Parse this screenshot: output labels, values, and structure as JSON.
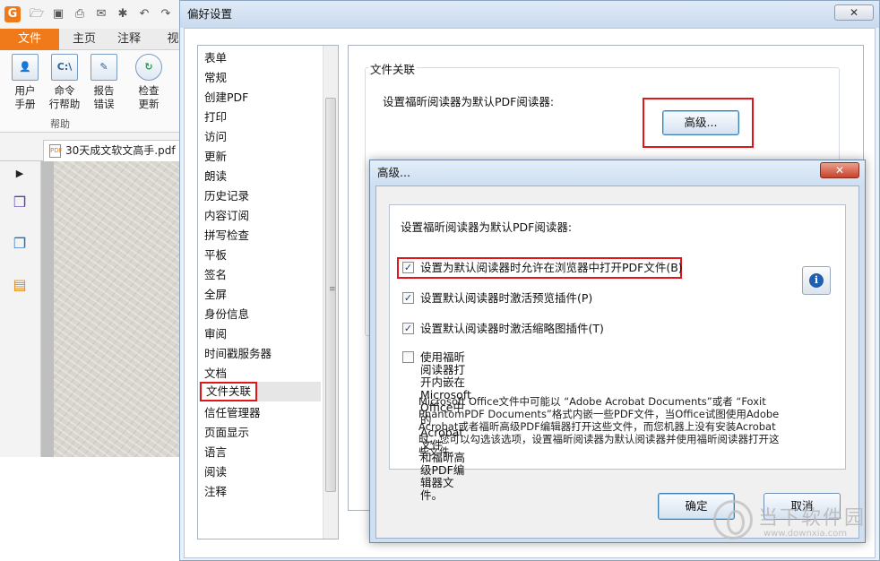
{
  "app": {
    "quick_access_icons": [
      "open-icon",
      "save-icon",
      "print-icon",
      "email-icon",
      "new-icon",
      "undo-icon",
      "redo-icon"
    ],
    "ribbon_tabs": [
      "文件",
      "主页",
      "注释",
      "视"
    ],
    "ribbon_buttons": [
      {
        "label": "用户\n手册",
        "icon": "user-manual-icon"
      },
      {
        "label": "命令\n行帮助",
        "icon": "command-line-icon",
        "icon_text": "C:\\"
      },
      {
        "label": "报告\n错误",
        "icon": "report-error-icon"
      },
      {
        "label": "检查\n更新",
        "icon": "check-update-icon"
      }
    ],
    "ribbon_group_label": "帮助",
    "document_tab": "30天成文软文高手.pdf",
    "colors": {
      "accent": "#f07a1a"
    }
  },
  "preferences": {
    "title": "偏好设置",
    "categories": [
      "表单",
      "常规",
      "创建PDF",
      "打印",
      "访问",
      "更新",
      "朗读",
      "历史记录",
      "内容订阅",
      "拼写检查",
      "平板",
      "签名",
      "全屏",
      "身份信息",
      "审阅",
      "时间戳服务器",
      "文档",
      "文件关联",
      "信任管理器",
      "页面显示",
      "语言",
      "阅读",
      "注释"
    ],
    "selected_category": "文件关联",
    "file_association": {
      "group_title": "文件关联",
      "default_reader_label": "设置福昕阅读器为默认PDF阅读器:",
      "advanced_button": "高级..."
    }
  },
  "advanced_dialog": {
    "title": "高级...",
    "heading": "设置福昕阅读器为默认PDF阅读器:",
    "options": [
      {
        "label": "设置为默认阅读器时允许在浏览器中打开PDF文件(B)",
        "checked": true
      },
      {
        "label": "设置默认阅读器时激活预览插件(P)",
        "checked": true
      },
      {
        "label": "设置默认阅读器时激活缩略图插件(T)",
        "checked": true
      },
      {
        "label": "使用福昕阅读器打开内嵌在Microsoft Office中的Acrobat文件\n和福昕高级PDF编辑器文件。",
        "checked": false
      }
    ],
    "description": "Microsoft Office文件中可能以 “Adobe Acrobat Documents”或者 “Foxit\nPhantomPDF Documents”格式内嵌一些PDF文件，当Office试图使用Adobe\nAcrobat或者福昕高级PDF编辑器打开这些文件，而您机器上没有安装Acrobat\n时，您可以勾选该选项，设置福昕阅读器为默认阅读器并使用福昕阅读器打开这\n些文件。",
    "ok_button": "确定",
    "cancel_button": "取消",
    "highlight_color": "#e0161b"
  },
  "watermark": {
    "name": "当下软件园",
    "url": "www.downxia.com"
  }
}
